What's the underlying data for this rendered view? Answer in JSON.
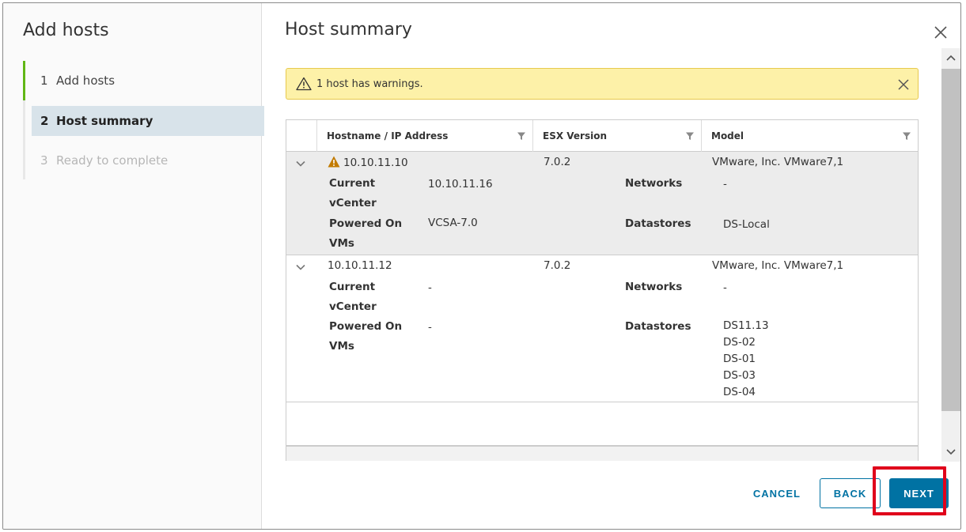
{
  "sidebar": {
    "title": "Add hosts",
    "steps": [
      {
        "num": "1",
        "label": "Add hosts",
        "state": "done"
      },
      {
        "num": "2",
        "label": "Host summary",
        "state": "current"
      },
      {
        "num": "3",
        "label": "Ready to complete",
        "state": "disabled"
      }
    ]
  },
  "main": {
    "title": "Host summary",
    "alert": {
      "text": "1 host has warnings."
    },
    "columns": [
      "Hostname / IP Address",
      "ESX Version",
      "Model"
    ],
    "hosts": [
      {
        "hostname": "10.10.11.10",
        "warning": true,
        "esx_version": "7.0.2",
        "model": "VMware, Inc. VMware7,1",
        "details": {
          "current_vcenter_label": "Current vCenter",
          "current_vcenter_label_1": "Current",
          "current_vcenter_label_2": "vCenter",
          "current_vcenter": "10.10.11.16",
          "powered_on_vms_label_1": "Powered On",
          "powered_on_vms_label_2": "VMs",
          "powered_on_vms": "VCSA-7.0",
          "networks_label": "Networks",
          "networks": "-",
          "datastores_label": "Datastores",
          "datastores": [
            "DS-Local"
          ]
        }
      },
      {
        "hostname": "10.10.11.12",
        "warning": false,
        "esx_version": "7.0.2",
        "model": "VMware, Inc. VMware7,1",
        "details": {
          "current_vcenter_label_1": "Current",
          "current_vcenter_label_2": "vCenter",
          "current_vcenter": "-",
          "powered_on_vms_label_1": "Powered On",
          "powered_on_vms_label_2": "VMs",
          "powered_on_vms": "-",
          "networks_label": "Networks",
          "networks": "-",
          "datastores_label": "Datastores",
          "datastores": [
            "DS11.13",
            "DS-02",
            "DS-01",
            "DS-03",
            "DS-04"
          ]
        }
      }
    ]
  },
  "footer": {
    "cancel_label": "CANCEL",
    "back_label": "BACK",
    "next_label": "NEXT"
  },
  "colors": {
    "accent": "#0072a3",
    "step_done": "#61b715",
    "alert_bg": "#fdf1a8",
    "warning_icon": "#c27b00",
    "highlight": "#e0001b"
  },
  "icons": [
    "alert-triangle-icon",
    "close-icon",
    "filter-icon",
    "chevron-down-icon",
    "warning-icon",
    "scroll-up-arrow-icon",
    "scroll-down-arrow-icon"
  ]
}
